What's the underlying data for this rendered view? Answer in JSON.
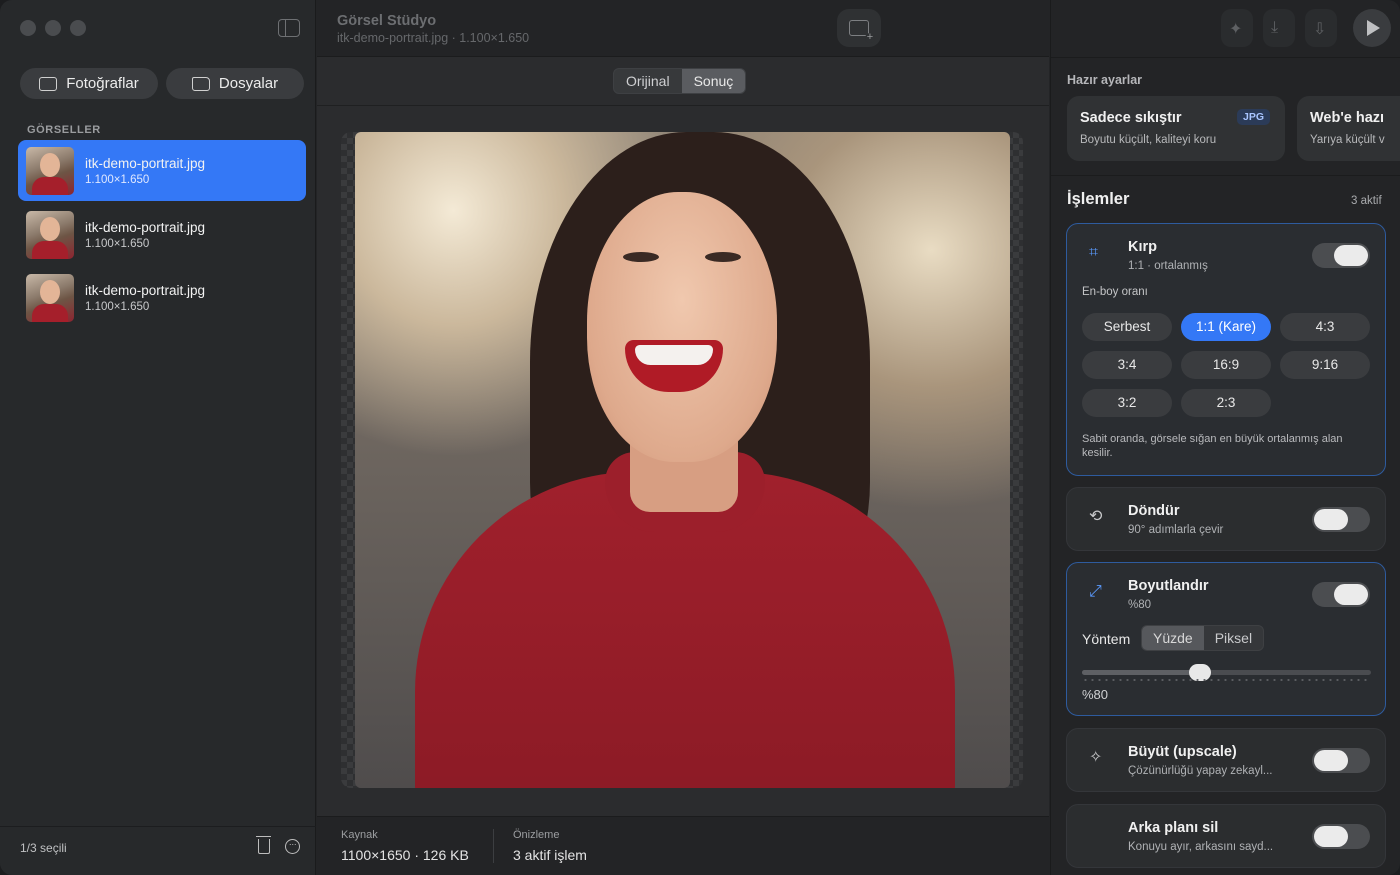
{
  "sidebar": {
    "sources": [
      {
        "label": "Fotoğraflar",
        "icon": "photos-icon"
      },
      {
        "label": "Dosyalar",
        "icon": "folder-icon"
      }
    ],
    "section_label": "GÖRSELLER",
    "files": [
      {
        "name": "itk-demo-portrait.jpg",
        "dims": "1.100×1.650"
      },
      {
        "name": "itk-demo-portrait.jpg",
        "dims": "1.100×1.650"
      },
      {
        "name": "itk-demo-portrait.jpg",
        "dims": "1.100×1.650"
      }
    ],
    "selection": "1/3 seçili"
  },
  "header": {
    "title": "Görsel Stüdyo",
    "subtitle": "itk-demo-portrait.jpg · 1.100×1.650"
  },
  "view_toggle": {
    "options": [
      "Orijinal",
      "Sonuç"
    ],
    "active": "Sonuç"
  },
  "status": {
    "source_label": "Kaynak",
    "source_value": "1100×1650 · 126 KB",
    "preview_label": "Önizleme",
    "preview_value": "3 aktif işlem"
  },
  "presets": {
    "title": "Hazır ayarlar",
    "items": [
      {
        "title": "Sadece sıkıştır",
        "subtitle": "Boyutu küçült, kaliteyi koru",
        "badge": "JPG"
      },
      {
        "title": "Web'e hazı",
        "subtitle": "Yarıya küçült v"
      }
    ]
  },
  "operations": {
    "title": "İşlemler",
    "count": "3 aktif",
    "crop": {
      "title": "Kırp",
      "subtitle": "1:1 · ortalanmış",
      "enabled": true,
      "ratio_label": "En-boy oranı",
      "ratios": [
        "Serbest",
        "1:1 (Kare)",
        "4:3",
        "3:4",
        "16:9",
        "9:16",
        "3:2",
        "2:3"
      ],
      "active_ratio": "1:1 (Kare)",
      "note": "Sabit oranda, görsele sığan en büyük ortalanmış alan kesilir."
    },
    "rotate": {
      "title": "Döndür",
      "subtitle": "90° adımlarla çevir",
      "enabled": false
    },
    "resize": {
      "title": "Boyutlandır",
      "subtitle": "%80",
      "enabled": true,
      "method_label": "Yöntem",
      "methods": [
        "Yüzde",
        "Piksel"
      ],
      "active_method": "Yüzde",
      "slider_value": 0.4,
      "value_text": "%80"
    },
    "upscale": {
      "title": "Büyüt (upscale)",
      "subtitle": "Çözünürlüğü yapay zekayl...",
      "enabled": false
    },
    "remove_bg": {
      "title": "Arka planı sil",
      "subtitle": "Konuyu ayır, arkasını sayd...",
      "enabled": false
    }
  },
  "colors": {
    "accent": "#3478f6",
    "card_border_active": "#2e5b9e"
  }
}
